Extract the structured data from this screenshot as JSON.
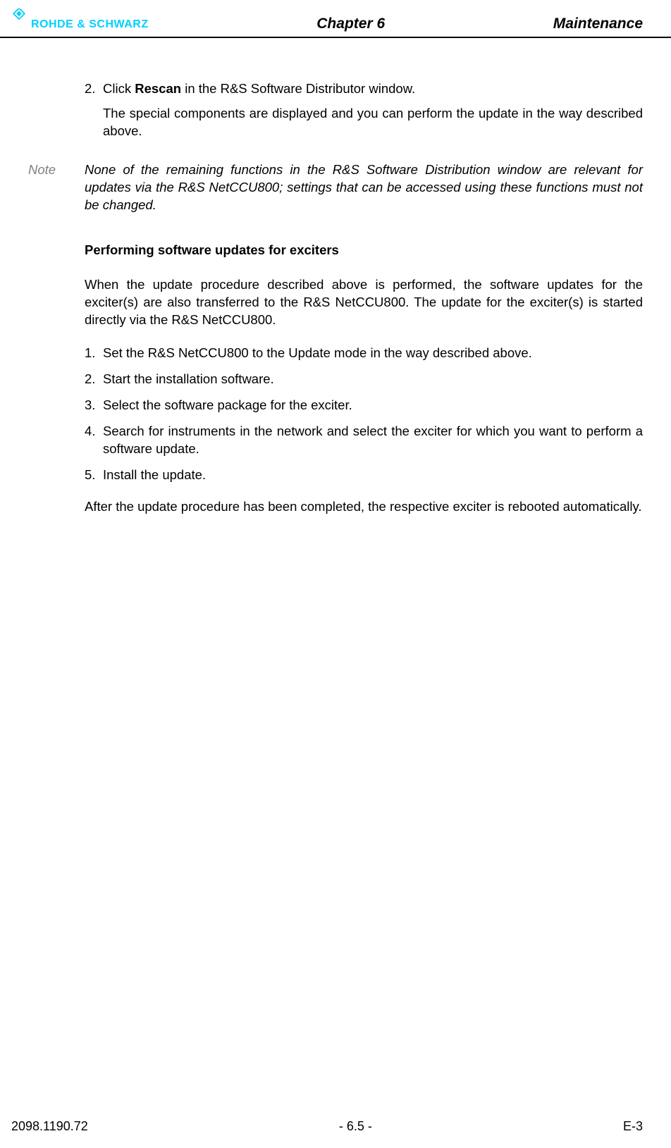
{
  "header": {
    "logo_text": "ROHDE & SCHWARZ",
    "chapter": "Chapter 6",
    "title": "Maintenance"
  },
  "body": {
    "step2_num": "2.",
    "step2_prefix": "Click ",
    "step2_bold": "Rescan",
    "step2_suffix": " in the R&S Software Distributor window.",
    "step2_sub": "The special components are displayed and you can perform the update in the way described above.",
    "note_label": "Note",
    "note_text": "None of the remaining functions in the R&S Software Distribution window are relevant for updates via the R&S NetCCU800; settings that can be accessed using these functions must not be changed.",
    "section_heading": "Performing software updates for exciters",
    "intro_para": "When the update procedure described above is performed, the software updates for the exciter(s) are also transferred to the R&S NetCCU800. The update for the exciter(s) is started directly via the R&S NetCCU800.",
    "steps": [
      {
        "num": "1.",
        "text": "Set the R&S NetCCU800 to the Update mode in the way described above."
      },
      {
        "num": "2.",
        "text": "Start the installation software."
      },
      {
        "num": "3.",
        "text": "Select the software package for the exciter."
      },
      {
        "num": "4.",
        "text": "Search for instruments in the network and select the exciter for which you want to perform a software update."
      },
      {
        "num": "5.",
        "text": "Install the update."
      }
    ],
    "closing_para": "After the update procedure has been completed, the respective exciter is rebooted automatically."
  },
  "footer": {
    "left": "2098.1190.72",
    "center": "- 6.5 -",
    "right": "E-3"
  }
}
